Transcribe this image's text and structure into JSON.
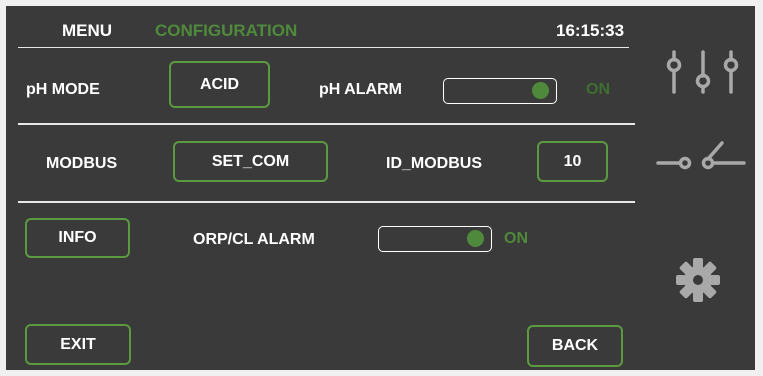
{
  "header": {
    "menu_label": "MENU",
    "section_label": "CONFIGURATION",
    "clock": "16:15:33"
  },
  "row1": {
    "ph_mode_label": "pH MODE",
    "ph_mode_button": "ACID",
    "ph_alarm_label": "pH ALARM",
    "ph_alarm_state": "ON"
  },
  "row2": {
    "modbus_label": "MODBUS",
    "set_com_button": "SET_COM",
    "id_modbus_label": "ID_MODBUS",
    "id_modbus_value": "10"
  },
  "row3": {
    "info_button": "INFO",
    "orp_alarm_label": "ORP/CL ALARM",
    "orp_alarm_state": "ON"
  },
  "footer": {
    "exit_button": "EXIT",
    "back_button": "BACK"
  },
  "sidebar": {
    "icons": [
      "sliders-icon",
      "switch-icon",
      "gear-icon"
    ]
  },
  "colors": {
    "background": "#3a3a3a",
    "accent_green": "#4f8a3c",
    "text": "#ffffff"
  }
}
